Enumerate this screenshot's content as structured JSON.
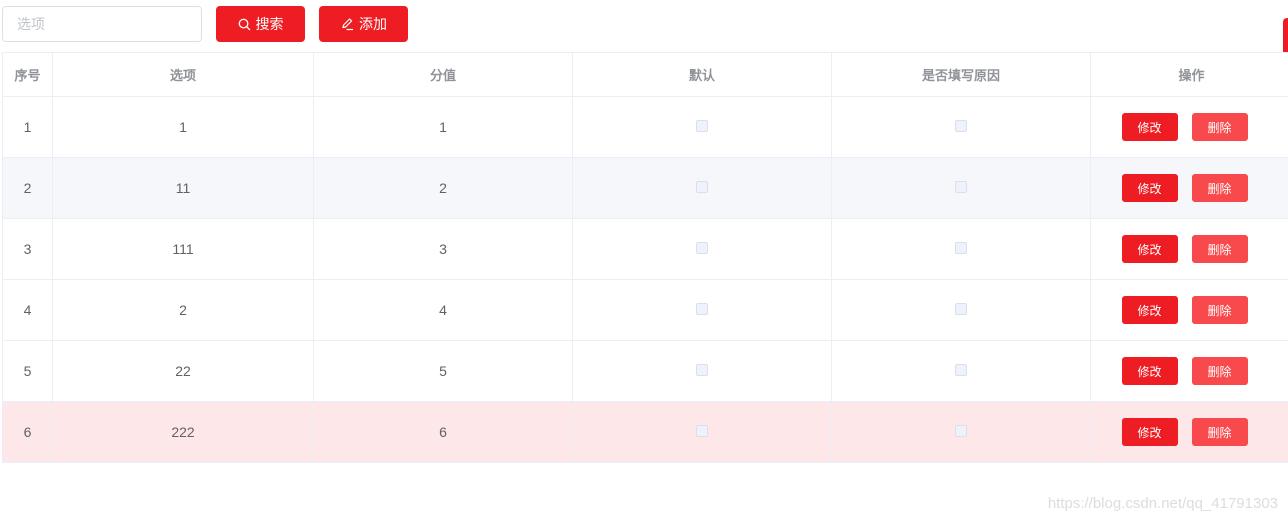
{
  "toolbar": {
    "search": {
      "placeholder": "选项",
      "value": ""
    },
    "search_button_label": "搜索",
    "add_button_label": "添加",
    "search_icon": "search-icon",
    "add_icon": "edit-icon"
  },
  "table": {
    "headers": [
      "序号",
      "选项",
      "分值",
      "默认",
      "是否填写原因",
      "操作"
    ],
    "rows": [
      {
        "index": "1",
        "option": "1",
        "score": "1",
        "default_checked": false,
        "reason_checked": false,
        "edit_label": "修改",
        "delete_label": "删除"
      },
      {
        "index": "2",
        "option": "11",
        "score": "2",
        "default_checked": false,
        "reason_checked": false,
        "edit_label": "修改",
        "delete_label": "删除"
      },
      {
        "index": "3",
        "option": "111",
        "score": "3",
        "default_checked": false,
        "reason_checked": false,
        "edit_label": "修改",
        "delete_label": "删除"
      },
      {
        "index": "4",
        "option": "2",
        "score": "4",
        "default_checked": false,
        "reason_checked": false,
        "edit_label": "修改",
        "delete_label": "删除"
      },
      {
        "index": "5",
        "option": "22",
        "score": "5",
        "default_checked": false,
        "reason_checked": false,
        "edit_label": "修改",
        "delete_label": "删除"
      },
      {
        "index": "6",
        "option": "222",
        "score": "6",
        "default_checked": false,
        "reason_checked": false,
        "edit_label": "修改",
        "delete_label": "删除"
      }
    ]
  },
  "watermark": "https://blog.csdn.net/qq_41791303",
  "colors": {
    "accent": "#ee1d23",
    "delete": "#f84a4d",
    "stripe": "#f5f7fa",
    "highlight_row": "#fde7e8"
  }
}
